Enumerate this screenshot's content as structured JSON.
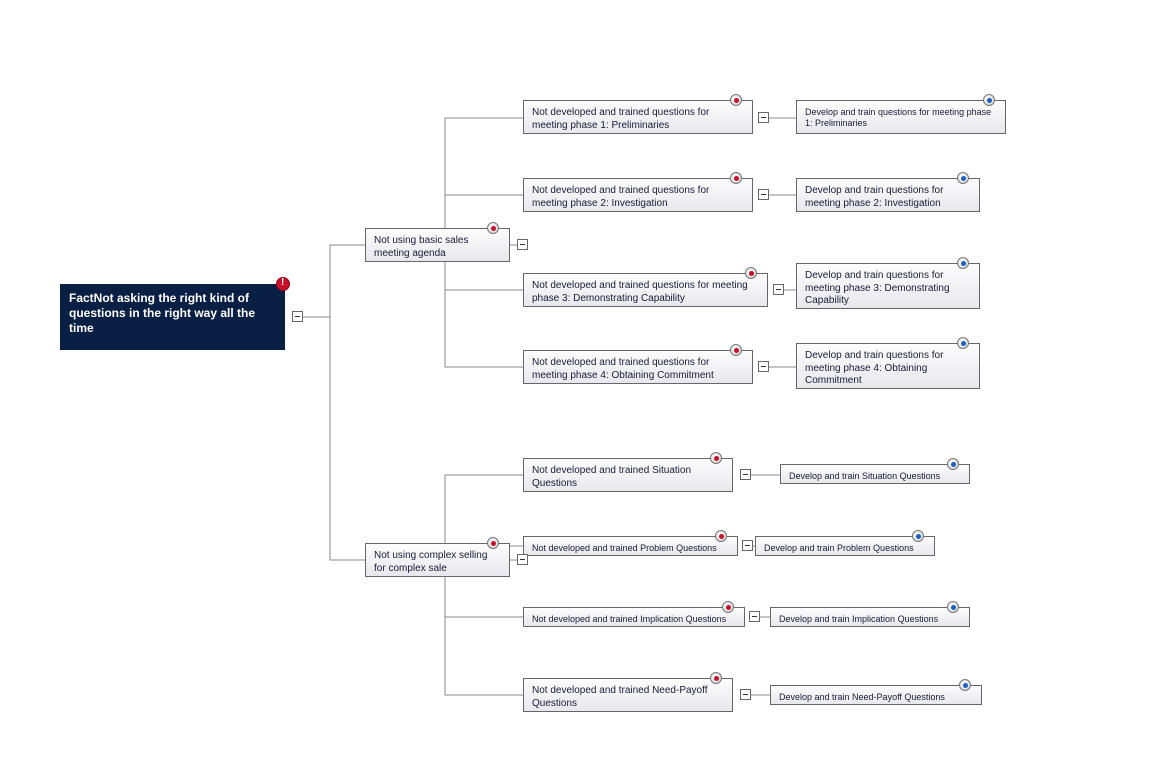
{
  "root": {
    "text": "FactNot asking the right kind of questions in the right way all the time",
    "icon": "alert"
  },
  "branches": [
    {
      "text": "Not using basic sales meeting agenda",
      "icon": "red",
      "children": [
        {
          "text": "Not developed and trained questions for meeting phase 1: Preliminaries",
          "icon": "red",
          "action": {
            "text": "Develop and train questions for meeting phase 1: Preliminaries",
            "icon": "blue"
          }
        },
        {
          "text": "Not developed and trained questions for meeting phase 2: Investigation",
          "icon": "red",
          "action": {
            "text": "Develop and train questions for meeting phase 2: Investigation",
            "icon": "blue"
          }
        },
        {
          "text": "Not developed and trained questions for meeting phase 3: Demonstrating Capability",
          "icon": "red",
          "action": {
            "text": "Develop and train questions for meeting phase 3: Demonstrating Capability",
            "icon": "blue"
          }
        },
        {
          "text": "Not developed and trained questions for meeting phase 4: Obtaining Commitment",
          "icon": "red",
          "action": {
            "text": "Develop and train questions for meeting phase 4: Obtaining Commitment",
            "icon": "blue"
          }
        }
      ]
    },
    {
      "text": "Not using complex selling for complex sale",
      "icon": "red",
      "children": [
        {
          "text": "Not developed and trained Situation Questions",
          "icon": "red",
          "action": {
            "text": "Develop and train Situation Questions",
            "icon": "blue"
          }
        },
        {
          "text": "Not developed and trained Problem Questions",
          "icon": "red",
          "action": {
            "text": "Develop and train Problem Questions",
            "icon": "blue"
          }
        },
        {
          "text": "Not developed and trained Implication Questions",
          "icon": "red",
          "action": {
            "text": "Develop and train Implication Questions",
            "icon": "blue"
          }
        },
        {
          "text": "Not developed and trained Need-Payoff Questions",
          "icon": "red",
          "action": {
            "text": "Develop and train Need-Payoff Questions",
            "icon": "blue"
          }
        }
      ]
    }
  ]
}
